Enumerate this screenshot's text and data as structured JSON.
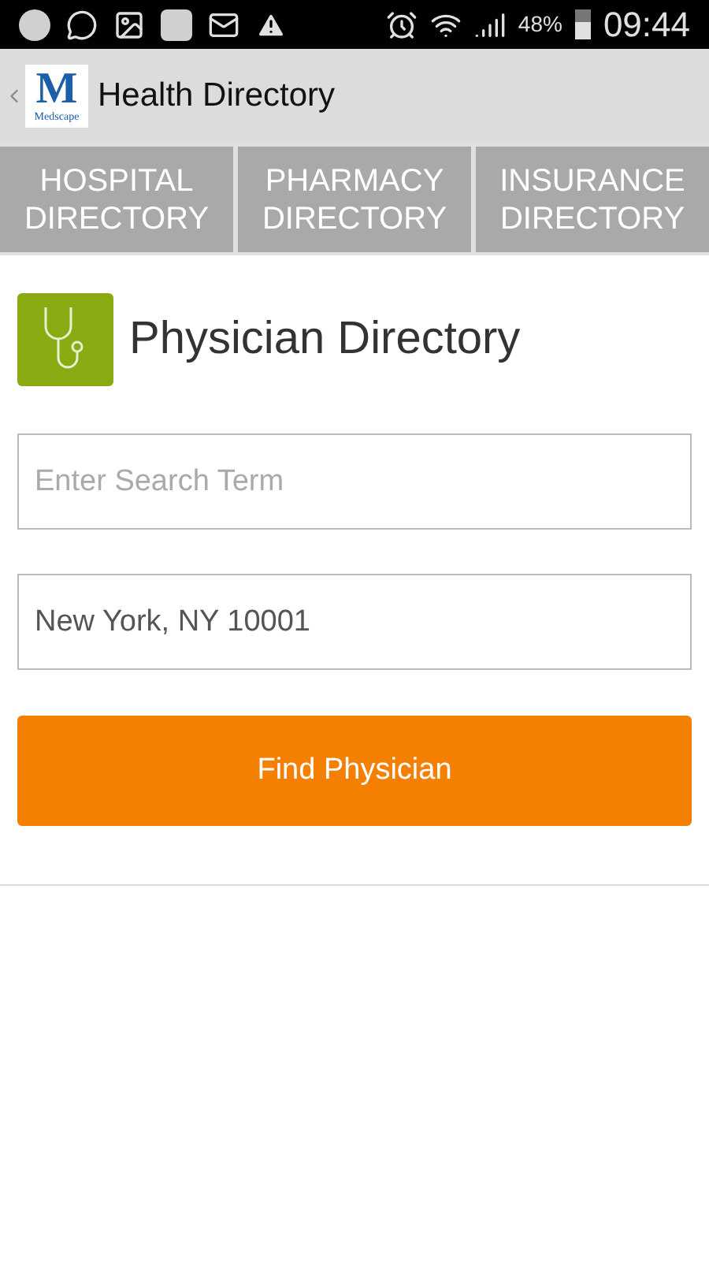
{
  "status_bar": {
    "battery": "48%",
    "time": "09:44"
  },
  "app_bar": {
    "logo_letter": "M",
    "logo_word": "Medscape",
    "title": "Health Directory"
  },
  "tabs": [
    {
      "line1": "HOSPITAL",
      "line2": "DIRECTORY"
    },
    {
      "line1": "PHARMACY",
      "line2": "DIRECTORY"
    },
    {
      "line1": "INSURANCE",
      "line2": "DIRECTORY"
    }
  ],
  "section": {
    "title": "Physician Directory"
  },
  "search": {
    "placeholder": "Enter Search Term"
  },
  "location": {
    "value": "New York, NY 10001"
  },
  "button": {
    "label": "Find Physician"
  }
}
